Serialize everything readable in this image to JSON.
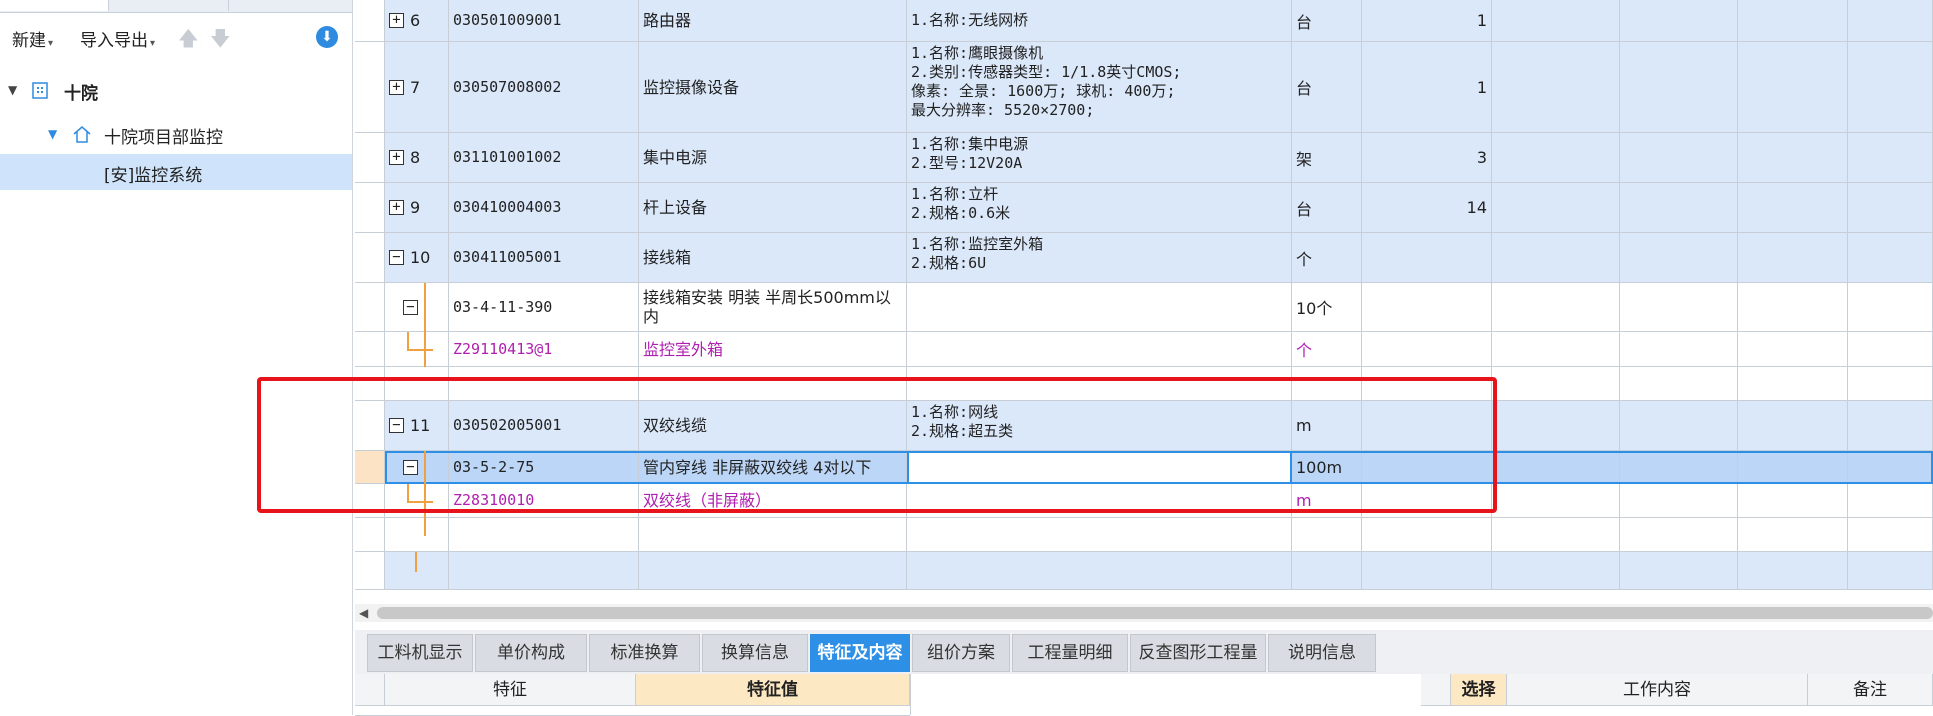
{
  "left_panel": {
    "toolbar": {
      "new_label": "新建",
      "import_export_label": "导入导出"
    },
    "tree": [
      {
        "label": "十院"
      },
      {
        "label": "十院项目部监控"
      },
      {
        "label": "[安]监控系统"
      }
    ]
  },
  "grid": {
    "rows": [
      {
        "num": "6",
        "code": "030501009001",
        "name": "路由器",
        "feature": "1.名称:无线网桥",
        "unit": "台",
        "qty": "1"
      },
      {
        "num": "7",
        "code": "030507008002",
        "name": "监控摄像设备",
        "feature": "1.名称:鹰眼摄像机\n2.类别:传感器类型: 1/1.8英寸CMOS;\n像素: 全景: 1600万; 球机: 400万;\n最大分辨率: 5520×2700;",
        "unit": "台",
        "qty": "1"
      },
      {
        "num": "8",
        "code": "031101001002",
        "name": "集中电源",
        "feature": "1.名称:集中电源\n2.型号:12V20A",
        "unit": "架",
        "qty": "3"
      },
      {
        "num": "9",
        "code": "030410004003",
        "name": "杆上设备",
        "feature": "1.名称:立杆\n2.规格:0.6米",
        "unit": "台",
        "qty": "14"
      },
      {
        "num": "10",
        "code": "030411005001",
        "name": "接线箱",
        "feature": "1.名称:监控室外箱\n2.规格:6U",
        "unit": "个",
        "qty": ""
      },
      {
        "num": "",
        "code": "03-4-11-390",
        "name": "接线箱安装 明装 半周长500mm以\n内",
        "feature": "",
        "unit": "10个",
        "qty": ""
      },
      {
        "num": "",
        "code": "Z29110413@1",
        "name": "监控室外箱",
        "feature": "",
        "unit": "个",
        "qty": ""
      },
      {
        "num": "",
        "code": "",
        "name": "",
        "feature": "",
        "unit": "",
        "qty": ""
      },
      {
        "num": "11",
        "code": "030502005001",
        "name": "双绞线缆",
        "feature": "1.名称:网线\n2.规格:超五类",
        "unit": "m",
        "qty": ""
      },
      {
        "num": "",
        "code": "03-5-2-75",
        "name": "管内穿线 非屏蔽双绞线 4对以下",
        "feature": "",
        "unit": "100m",
        "qty": ""
      },
      {
        "num": "",
        "code": "Z28310010",
        "name": "双绞线（非屏蔽）",
        "feature": "",
        "unit": "m",
        "qty": ""
      }
    ]
  },
  "bottom_tabs": [
    "工料机显示",
    "单价构成",
    "标准换算",
    "换算信息",
    "特征及内容",
    "组价方案",
    "工程量明细",
    "反查图形工程量",
    "说明信息"
  ],
  "active_bottom_tab": "特征及内容",
  "feature_table": {
    "col_feature": "特征",
    "col_value": "特征值"
  },
  "work_table": {
    "col_select": "选择",
    "col_content": "工作内容",
    "col_note": "备注"
  },
  "colors": {
    "accent": "#2d8fe6",
    "row_blue": "#dbe8fa",
    "purple_text": "#b020b0",
    "highlight_red": "#e8141c"
  }
}
